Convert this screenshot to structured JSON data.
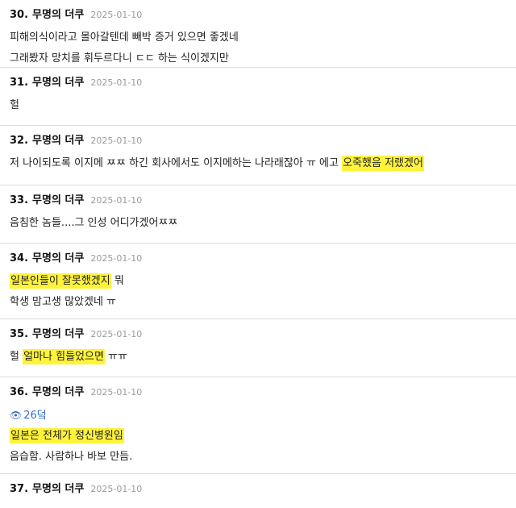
{
  "comments": [
    {
      "number": "30.",
      "author": "무명의 더쿠",
      "date": "2025-01-10",
      "lines": [
        {
          "pre": "피해의식이라고 몰아갈텐데 빼박 증거 있으면 좋겠네",
          "hl": "",
          "post": ""
        },
        {
          "pre": "그래봤자 망치를 휘두르다니 ㄷㄷ 하는 식이겠지만",
          "hl": "",
          "post": ""
        }
      ]
    },
    {
      "number": "31.",
      "author": "무명의 더쿠",
      "date": "2025-01-10",
      "lines": [
        {
          "pre": "헐",
          "hl": "",
          "post": ""
        }
      ]
    },
    {
      "number": "32.",
      "author": "무명의 더쿠",
      "date": "2025-01-10",
      "lines": [
        {
          "pre": "저 나이되도록 이지메 ㅉㅉ 하긴 회사에서도 이지메하는 나라래잖아 ㅠ 에고 ",
          "hl": "오죽했음 저랬겠어",
          "post": ""
        }
      ]
    },
    {
      "number": "33.",
      "author": "무명의 더쿠",
      "date": "2025-01-10",
      "lines": [
        {
          "pre": "음침한 놈들....그 인성 어디가겠어ㅉㅉ",
          "hl": "",
          "post": ""
        }
      ]
    },
    {
      "number": "34.",
      "author": "무명의 더쿠",
      "date": "2025-01-10",
      "lines": [
        {
          "pre": "",
          "hl": "일본인들이 잘못했겠지",
          "post": " 뭐"
        },
        {
          "pre": "학생 맘고생 많았겠네 ㅠ",
          "hl": "",
          "post": ""
        }
      ]
    },
    {
      "number": "35.",
      "author": "무명의 더쿠",
      "date": "2025-01-10",
      "lines": [
        {
          "pre": "헐 ",
          "hl": "얼마나 힘들었으면",
          "post": " ㅠㅠ"
        }
      ]
    },
    {
      "number": "36.",
      "author": "무명의 더쿠",
      "date": "2025-01-10",
      "quote": {
        "icon": "reply-eye-icon",
        "text": "26덬"
      },
      "lines": [
        {
          "pre": "",
          "hl": "일본은 전체가 정신병원임",
          "post": ""
        },
        {
          "pre": "음습함. 사람하나 바보 만듬.",
          "hl": "",
          "post": ""
        }
      ]
    },
    {
      "number": "37.",
      "author": "무명의 더쿠",
      "date": "2025-01-10",
      "lines": []
    }
  ],
  "colors": {
    "highlight": "#fff33a",
    "divider": "#dcdcdc",
    "date": "#9a9a9a",
    "quote": "#3a6fb8"
  }
}
